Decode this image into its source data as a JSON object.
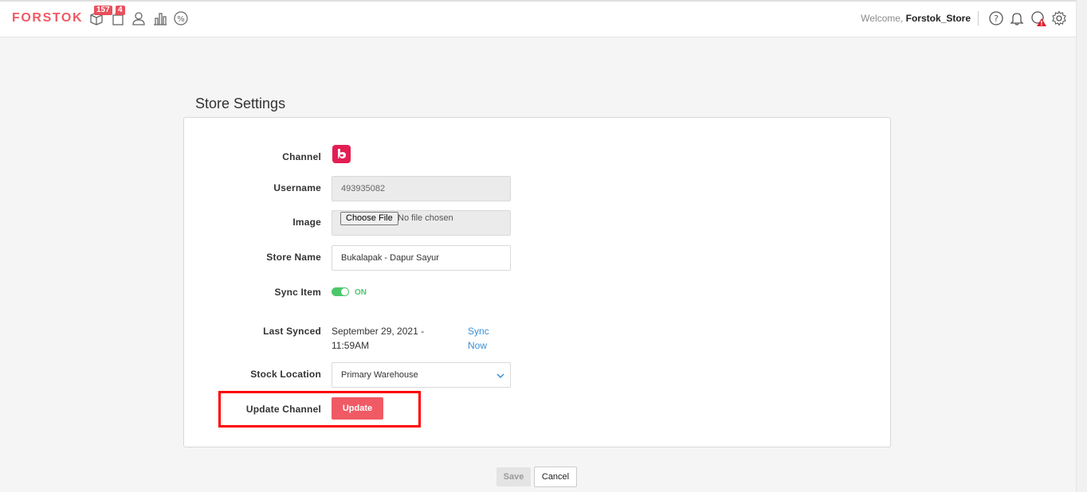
{
  "header": {
    "logo": "FORSTOK",
    "badges": {
      "inventory_count": "157",
      "orders_count": "4"
    },
    "welcome_prefix": "Welcome,",
    "username": "Forstok_Store",
    "icons": [
      "box-icon",
      "bag-icon",
      "user-icon",
      "bar-chart-icon",
      "percent-icon",
      "help-icon",
      "bell-icon",
      "alert-icon",
      "gear-icon"
    ]
  },
  "page": {
    "title": "Store Settings"
  },
  "form": {
    "channel_label": "Channel",
    "channel_icon": "bukalapak-logo-icon",
    "username_label": "Username",
    "username_value": "493935082",
    "image_label": "Image",
    "file_button": "Choose File",
    "file_status": "No file chosen",
    "store_name_label": "Store Name",
    "store_name_value": "Bukalapak - Dapur Sayur",
    "sync_item_label": "Sync Item",
    "sync_item_state": "ON",
    "last_synced_label": "Last Synced",
    "last_synced_value": "September 29, 2021 - 11:59AM",
    "sync_now_link": "Sync Now",
    "stock_location_label": "Stock Location",
    "stock_location_value": "Primary Warehouse",
    "update_channel_label": "Update Channel",
    "update_button": "Update"
  },
  "footer": {
    "save_button": "Save",
    "cancel_button": "Cancel"
  },
  "colors": {
    "brand": "#f05a64",
    "badge": "#e8505b",
    "toggle_on": "#4cc76a",
    "link": "#3a8fd6",
    "highlight": "#ff0000",
    "channel_logo": "#e31e52"
  }
}
